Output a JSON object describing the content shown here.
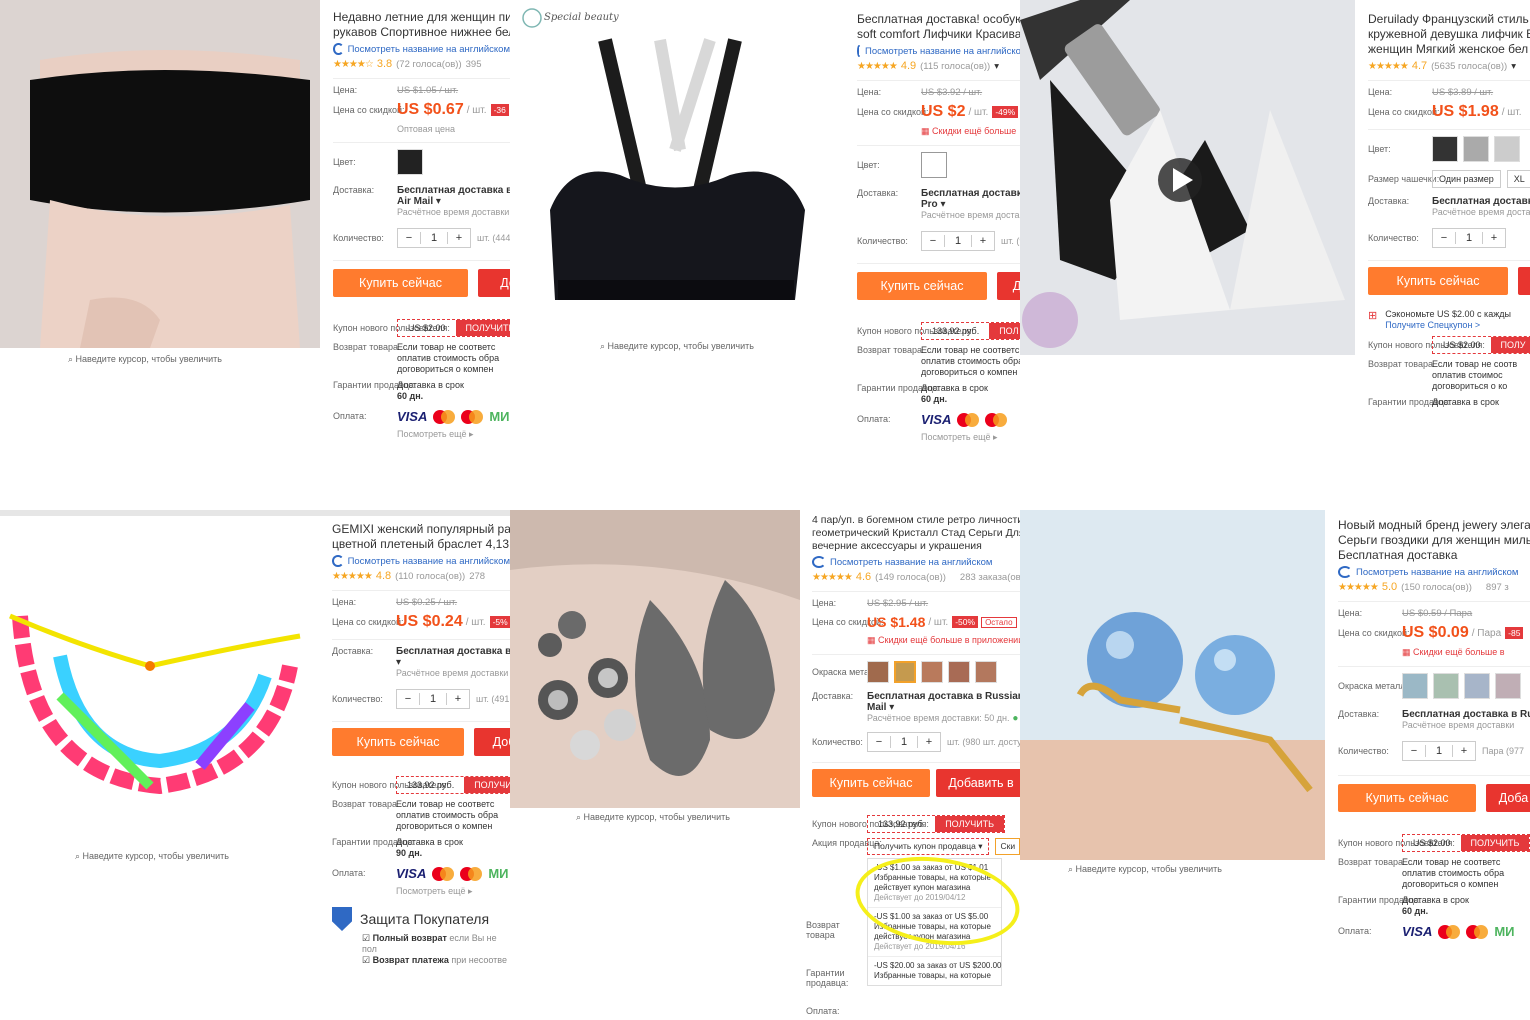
{
  "common": {
    "hover_zoom": "Наведите курсор, чтобы увеличить",
    "translate": "Посмотреть название на английском",
    "price_lbl": "Цена:",
    "disc_lbl": "Цена со скидкой:",
    "color_lbl": "Цвет:",
    "ship_lbl": "Доставка:",
    "qty_lbl": "Количество:",
    "buy": "Купить сейчас",
    "coupon_lbl": "Купон нового пользователя:",
    "get": "ПОЛУЧИТЬ",
    "return_lbl": "Возврат товара",
    "return_txt": [
      "Если товар не соответс",
      "оплатив стоимость обра",
      "договориться о компен"
    ],
    "guarantee_lbl": "Гарантии продавца:",
    "deliv_txt": "Доставка в срок",
    "pay_lbl": "Оплата:",
    "more": "Посмотреть ещё",
    "visa": "VISA",
    "mir": "МИ",
    "calc": "Расчётное время доставки"
  },
  "t1": {
    "title1": "Недавно летние для женщин пик",
    "title2": "рукавов Спортивное нижнее бел",
    "rating": "3.8",
    "votes": "(72 голоса(ов))",
    "orders": "395",
    "old": "US $1.05 / шт.",
    "price": "US $0.67",
    "unit": "/ шт.",
    "disc": "-36",
    "wholesale": "Оптовая цена",
    "ship": "Бесплатная доставка в R",
    "ship2": "Air Mail",
    "stock": "шт. (444",
    "buy2": "До",
    "coupon": "US $2.00",
    "days": "60 дн."
  },
  "t2": {
    "brand": "Special beauty",
    "title1": "Бесплатная доставка! особую кр",
    "title2": "soft comfort Лифчики Красивая",
    "rating": "4.9",
    "votes": "(115 голоса(ов))",
    "old": "US $3.92 / шт.",
    "price": "US $2",
    "unit": "/ шт.",
    "disc": "-49%",
    "app": "Скидки ещё больше",
    "ship": "Бесплатная доставка в",
    "ship2": "Pro",
    "stock": "шт. (9",
    "buy2": "Д",
    "coupon": "133,92 руб.",
    "get": "ПОЛ",
    "days": "60 дн."
  },
  "t3": {
    "title1": "Deruilady Французский стиль",
    "title2": "кружевной девушка лифчик Б",
    "title3": "женщин Мягкий женское бел",
    "rating": "4.7",
    "votes": "(5635 голоса(ов))",
    "old": "US $3.89 / шт.",
    "price": "US $1.98",
    "unit": "/ шт.",
    "size_lbl": "Размер чашечки:",
    "size1": "Один размер",
    "size2": "XL",
    "ship": "Бесплатная доставк",
    "save": "Сэкономьте US $2.00 с кажды",
    "spec": "Получите Спецкупон >",
    "coupon": "US $2.00",
    "get": "ПОЛУ",
    "return1": "Если товар не соотв",
    "return2": "оплатив стоимос",
    "return3": "договориться о ко"
  },
  "t4": {
    "title1": "GEMIXI женский популярный разно",
    "title2": "цветной плетеный браслет 4,13",
    "rating": "4.8",
    "votes": "(110 голоса(ов))",
    "orders": "278",
    "old": "US $0.25 / шт.",
    "price": "US $0.24",
    "unit": "/ шт.",
    "disc": "-5%",
    "ship": "Бесплатная доставка в Rus",
    "stock": "шт. (491",
    "buy2": "Доб",
    "coupon": "133,92 руб.",
    "get": "ПОЛУЧИ",
    "days": "90 дн.",
    "protect": "Защита Покупателя",
    "p1a": "Полный возврат",
    "p1b": "если Вы не пол",
    "p2a": "Возврат платежа",
    "p2b": "при несоотве"
  },
  "t5": {
    "title1": "4 пар/уп. в богемном стиле ретро личности",
    "title2": "геометрический Кристалл Стад Серьги Для ж",
    "title3": "вечерние аксессуары и украшения",
    "rating": "4.6",
    "votes": "(149 голоса(ов))",
    "orders": "283 заказа(ов)",
    "old": "US $2.95 / шт.",
    "price": "US $1.48",
    "unit": "/ шт.",
    "disc": "-50%",
    "left": "Остало",
    "app": "Скидки ещё больше в приложении",
    "metal_lbl": "Окраска металла:",
    "ship": "Бесплатная доставка в Russian Federa",
    "ship2": "Mail",
    "time": "Расчётное время доставки: 50 дн.",
    "stock": "шт. (980 шт. доступн",
    "buy2": "Добавить в",
    "coupon": "133,92 руб.",
    "get": "ПОЛУЧИТЬ",
    "promo_lbl": "Акция продавца:",
    "seller_cpn": "Получить купон продавца",
    "skid": "Ски",
    "offers": [
      {
        "l1": "-US $1.00 за заказ от US $1.01",
        "l2": "Избранные товары, на которые",
        "l3": "действует купон магазина",
        "l4": "Действует до 2019/04/12"
      },
      {
        "l1": "-US $1.00 за заказ от US $5.00",
        "l2": "Избранные товары, на которые",
        "l3": "действует купон магазина",
        "l4": "Действует до 2019/04/16"
      },
      {
        "l1": "-US $20.00 за заказ от US $200.00",
        "l2": "Избранные товары, на которые",
        "l3": "",
        "l4": ""
      }
    ]
  },
  "t6": {
    "title1": "Новый модный бренд jewery элеган",
    "title2": "Серьги гвоздики для женщин миль",
    "title3": "Бесплатная доставка",
    "rating": "5.0",
    "votes": "(150 голоса(ов))",
    "orders": "897 з",
    "old": "US $0.59 / Пара",
    "price": "US $0.09",
    "unit": "/ Пара",
    "disc": "-85",
    "app": "Скидки ещё больше в",
    "metal_lbl": "Окраска металла:",
    "ship": "Бесплатная доставка в Rus",
    "stock": "Пара (977",
    "buy2": "Доба",
    "coupon": "US $2.00",
    "get": "ПОЛУЧИТЬ",
    "days": "60 дн."
  },
  "colors": {
    "accent": "#ff7b2e",
    "red": "#e4393c",
    "price": "#f2511a",
    "link": "#2f69c4",
    "highlight": "#f5ef1a"
  }
}
